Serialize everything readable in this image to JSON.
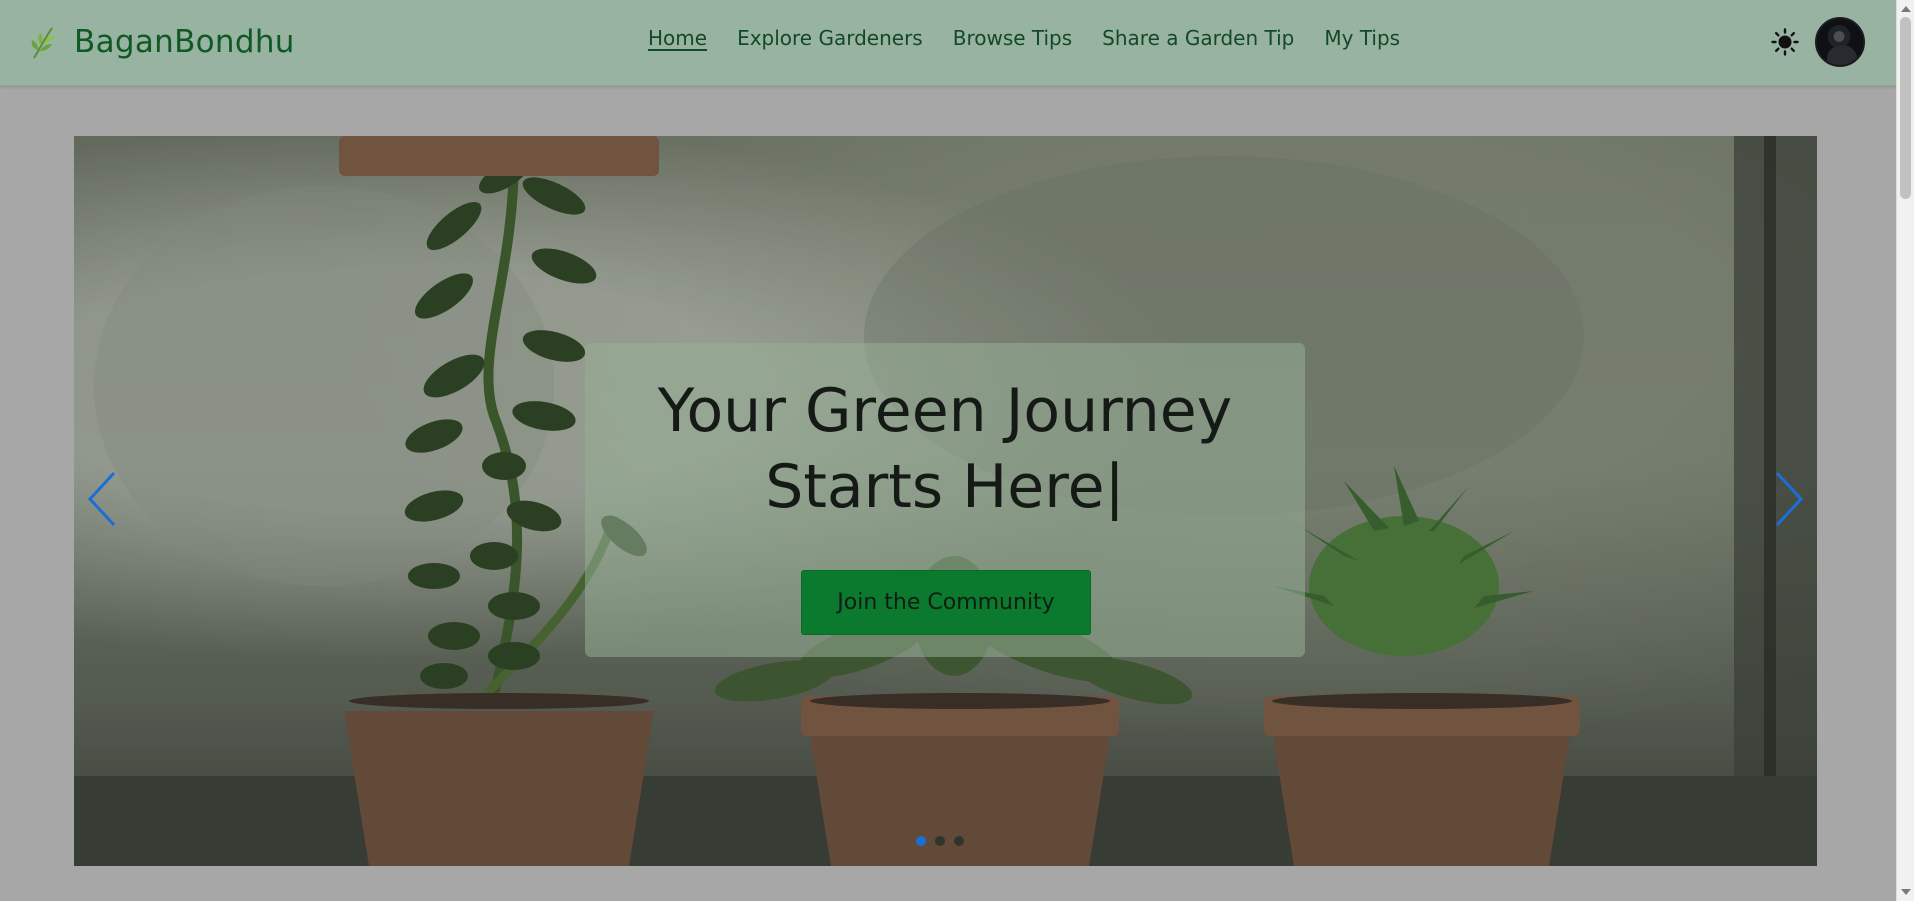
{
  "brand": {
    "name": "BaganBondhu",
    "icon": "leaf-icon"
  },
  "nav": {
    "links": [
      {
        "label": "Home",
        "active": true
      },
      {
        "label": "Explore Gardeners",
        "active": false
      },
      {
        "label": "Browse Tips",
        "active": false
      },
      {
        "label": "Share a Garden Tip",
        "active": false
      },
      {
        "label": "My Tips",
        "active": false
      }
    ],
    "theme_toggle_icon": "sun-icon",
    "avatar_icon": "user-avatar"
  },
  "hero": {
    "headline_line1": "Your Green Journey",
    "headline_line2": "Starts Here|",
    "cta_label": "Join the Community",
    "prev_icon": "chevron-left-icon",
    "next_icon": "chevron-right-icon",
    "slide_count": 3,
    "active_slide": 1
  },
  "colors": {
    "navbar_bg": "#98b3a2",
    "brand_green": "#0f5a24",
    "cta_bg": "#0b7a2f",
    "arrow_blue": "#1a6fd6"
  }
}
